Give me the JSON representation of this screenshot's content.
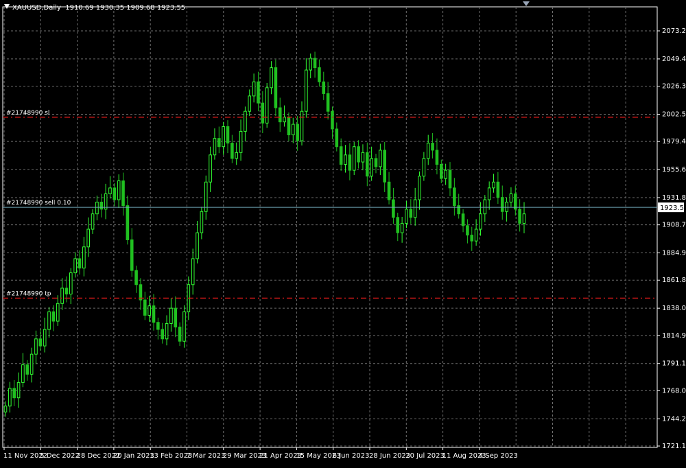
{
  "header": {
    "symbol": "XAUUSD,Daily",
    "ohlc": "1910.69 1930.35 1909.68 1923.55"
  },
  "colors": {
    "background": "#000000",
    "grid": "#6e6e6e",
    "bull": "#32ff32",
    "bear": "#20c020",
    "order_line": "#d01818",
    "price_line": "#6fa8b8"
  },
  "chart_data": {
    "type": "candlestick",
    "title": "XAUUSD,Daily",
    "y_axis": {
      "ticks": [
        "2073.20",
        "2049.40",
        "2026.30",
        "2002.50",
        "1979.40",
        "1955.60",
        "1931.80",
        "1908.70",
        "1884.90",
        "1861.80",
        "1838.00",
        "1814.90",
        "1791.10",
        "1768.00",
        "1744.20",
        "1721.10"
      ],
      "range": [
        1721.1,
        2073.2
      ],
      "position": "right"
    },
    "x_axis": {
      "ticks": [
        "11 Nov 2022",
        "5 Dec 2022",
        "28 Dec 2022",
        "20 Jan 2023",
        "13 Feb 2023",
        "7 Mar 2023",
        "29 Mar 2023",
        "21 Apr 2023",
        "15 May 2023",
        "6 Jun 2023",
        "28 Jun 2023",
        "20 Jul 2023",
        "11 Aug 2023",
        "4 Sep 2023"
      ]
    },
    "grid": true,
    "current_price": {
      "value": 1923.55,
      "label": "1923.55"
    },
    "order_lines": [
      {
        "label": "#21748990 sl",
        "value": 2000.0
      },
      {
        "label": "#21748990 sell 0.10",
        "value": 1923.55
      },
      {
        "label": "#21748990 tp",
        "value": 1846.5
      }
    ],
    "series": [
      {
        "close": [
          1755,
          1770,
          1762,
          1775,
          1790,
          1782,
          1799,
          1812,
          1806,
          1820,
          1835,
          1827,
          1842,
          1855,
          1850,
          1868,
          1880,
          1872,
          1890,
          1905,
          1918,
          1928,
          1922,
          1935,
          1940,
          1930,
          1946,
          1925,
          1896,
          1870,
          1858,
          1845,
          1832,
          1840,
          1826,
          1820,
          1812,
          1825,
          1838,
          1822,
          1810,
          1835,
          1858,
          1880,
          1902,
          1920,
          1945,
          1968,
          1982,
          1975,
          1992,
          1978,
          1965,
          1970,
          1988,
          2005,
          2018,
          2030,
          2012,
          1995,
          2025,
          2042,
          2008,
          1996,
          2000,
          1985,
          1994,
          1980,
          2005,
          2040,
          2050,
          2042,
          2030,
          2020,
          2005,
          1990,
          1975,
          1960,
          1968,
          1955,
          1975,
          1962,
          1970,
          1950,
          1965,
          1958,
          1972,
          1945,
          1930,
          1915,
          1902,
          1910,
          1922,
          1915,
          1930,
          1950,
          1965,
          1978,
          1972,
          1960,
          1948,
          1955,
          1940,
          1925,
          1918,
          1908,
          1900,
          1895,
          1905,
          1918,
          1930,
          1940,
          1945,
          1932,
          1920,
          1928,
          1935,
          1922,
          1910,
          1918
        ]
      }
    ]
  }
}
